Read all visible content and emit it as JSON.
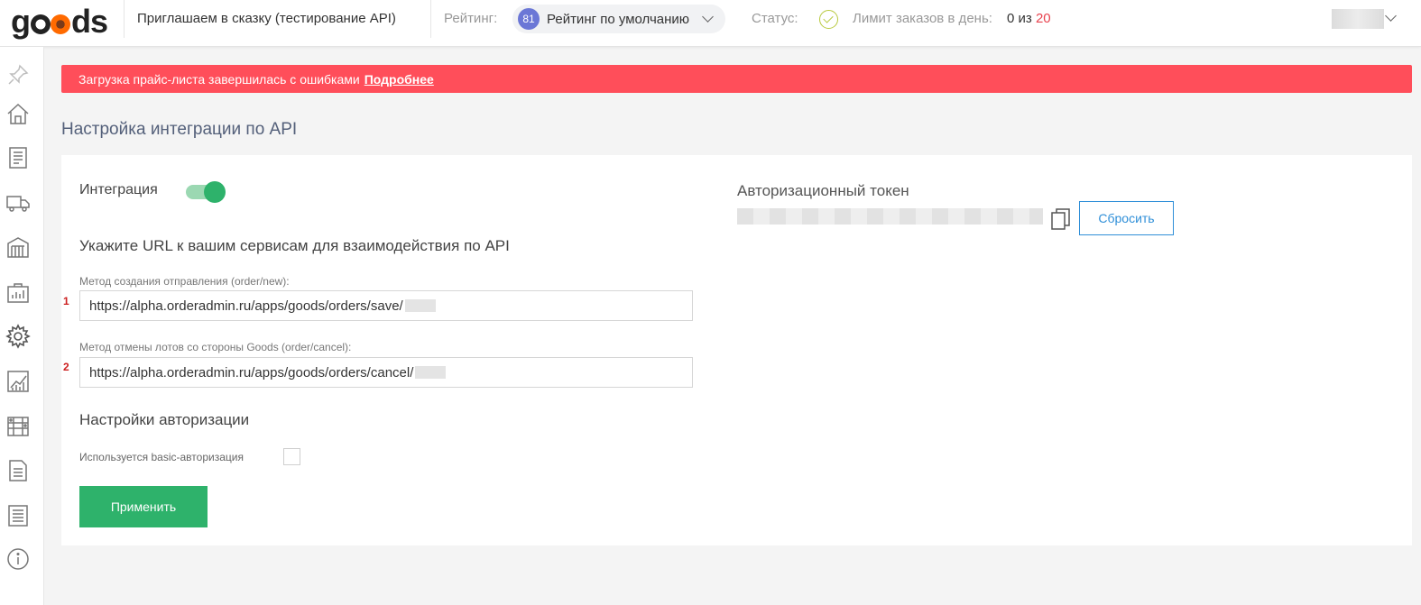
{
  "header": {
    "logo_text": "goods",
    "shop_name": "Приглашаем в сказку (тестирование API)",
    "rating_label": "Рейтинг:",
    "rating_value": "81",
    "rating_text": "Рейтинг по умолчанию",
    "status_label": "Статус:",
    "limit_label": "Лимит заказов в день:",
    "limit_current": "0 из",
    "limit_max": "20"
  },
  "sidebar": {
    "items": [
      "pin-icon",
      "home-icon",
      "catalog-icon",
      "delivery-truck-icon",
      "warehouse-icon",
      "analytics-icon",
      "gear-icon",
      "chart-icon",
      "calculator-icon",
      "documents-icon",
      "list-icon",
      "info-icon"
    ]
  },
  "alert": {
    "text": "Загрузка прайс-листа завершилась с ошибками",
    "link": "Подробнее",
    "color": "#ff4e5a"
  },
  "page": {
    "title": "Настройка интеграции по API"
  },
  "integration": {
    "label": "Интеграция",
    "enabled": true
  },
  "urls": {
    "heading": "Укажите URL к вашим сервисам для взаимодействия по API",
    "fields": [
      {
        "num": "1",
        "label": "Метод создания отправления (order/new):",
        "value": "https://alpha.orderadmin.ru/apps/goods/orders/save/"
      },
      {
        "num": "2",
        "label": "Метод отмены лотов со стороны Goods (order/cancel):",
        "value": "https://alpha.orderadmin.ru/apps/goods/orders/cancel/"
      }
    ]
  },
  "auth": {
    "heading": "Настройки авторизации",
    "basic_label": "Используется basic-авторизация",
    "basic_checked": false,
    "apply_label": "Применить"
  },
  "token": {
    "label": "Авторизационный токен",
    "reset_label": "Сбросить"
  },
  "colors": {
    "accent_green": "#2eb26b",
    "accent_blue": "#2f8fd8",
    "rating_badge": "#6b77d6",
    "limit_red": "#e8434f"
  }
}
